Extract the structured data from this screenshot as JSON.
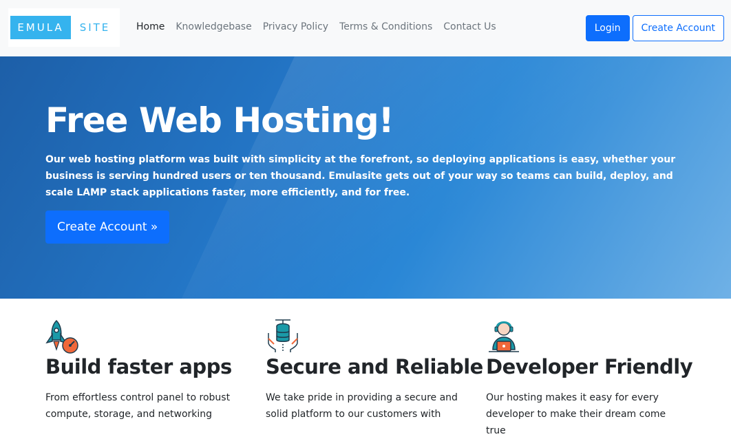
{
  "logo": {
    "left_text": "EMULA",
    "right_text": "SITE"
  },
  "nav": {
    "links": [
      {
        "label": "Home"
      },
      {
        "label": "Knowledgebase"
      },
      {
        "label": "Privacy Policy"
      },
      {
        "label": "Terms & Conditions"
      },
      {
        "label": "Contact Us"
      }
    ],
    "login_label": "Login",
    "create_account_label": "Create Account"
  },
  "hero": {
    "title": "Free Web Hosting!",
    "text": "Our web hosting platform was built with simplicity at the forefront, so deploying applications is easy, whether your business is serving hundred users or ten thousand. Emulasite gets out of your way so teams can build, deploy, and scale LAMP stack applications faster, more efficiently, and for free.",
    "cta_label": "Create Account »"
  },
  "features": [
    {
      "icon": "rocket-icon",
      "title": "Build faster apps",
      "text": "From effortless control panel to robust compute, storage, and networking"
    },
    {
      "icon": "database-hands-icon",
      "title": "Secure and Reliable",
      "text": "We take pride in providing a secure and solid platform to our customers with"
    },
    {
      "icon": "support-agent-icon",
      "title": "Developer Friendly",
      "text": "Our hosting makes it easy for every developer to make their dream come true"
    }
  ],
  "colors": {
    "primary": "#0d6efd",
    "logo_blue": "#35b3ee",
    "icon_teal": "#1b9aa8",
    "icon_orange": "#f0683a"
  }
}
